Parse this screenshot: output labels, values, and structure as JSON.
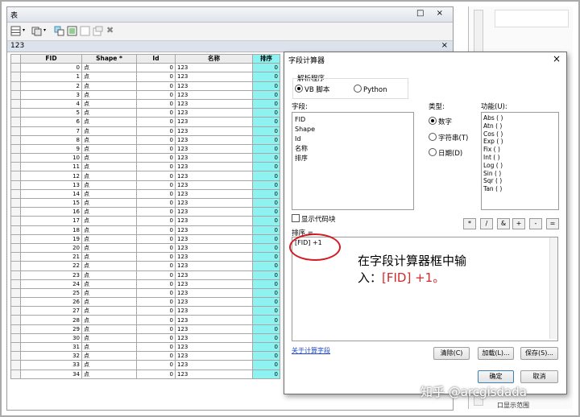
{
  "table_window": {
    "title": "表",
    "controls": "□ ×",
    "tab_name": "123",
    "tab_close": "×",
    "columns": [
      "FID",
      "Shape *",
      "Id",
      "名称",
      "排序"
    ],
    "rows": [
      [
        "0",
        "点",
        "0",
        "123",
        "0"
      ],
      [
        "1",
        "点",
        "0",
        "123",
        "0"
      ],
      [
        "2",
        "点",
        "0",
        "123",
        "0"
      ],
      [
        "3",
        "点",
        "0",
        "123",
        "0"
      ],
      [
        "4",
        "点",
        "0",
        "123",
        "0"
      ],
      [
        "5",
        "点",
        "0",
        "123",
        "0"
      ],
      [
        "6",
        "点",
        "0",
        "123",
        "0"
      ],
      [
        "7",
        "点",
        "0",
        "123",
        "0"
      ],
      [
        "8",
        "点",
        "0",
        "123",
        "0"
      ],
      [
        "9",
        "点",
        "0",
        "123",
        "0"
      ],
      [
        "10",
        "点",
        "0",
        "123",
        "0"
      ],
      [
        "11",
        "点",
        "0",
        "123",
        "0"
      ],
      [
        "12",
        "点",
        "0",
        "123",
        "0"
      ],
      [
        "13",
        "点",
        "0",
        "123",
        "0"
      ],
      [
        "14",
        "点",
        "0",
        "123",
        "0"
      ],
      [
        "15",
        "点",
        "0",
        "123",
        "0"
      ],
      [
        "16",
        "点",
        "0",
        "123",
        "0"
      ],
      [
        "17",
        "点",
        "0",
        "123",
        "0"
      ],
      [
        "18",
        "点",
        "0",
        "123",
        "0"
      ],
      [
        "19",
        "点",
        "0",
        "123",
        "0"
      ],
      [
        "20",
        "点",
        "0",
        "123",
        "0"
      ],
      [
        "21",
        "点",
        "0",
        "123",
        "0"
      ],
      [
        "22",
        "点",
        "0",
        "123",
        "0"
      ],
      [
        "23",
        "点",
        "0",
        "123",
        "0"
      ],
      [
        "24",
        "点",
        "0",
        "123",
        "0"
      ],
      [
        "25",
        "点",
        "0",
        "123",
        "0"
      ],
      [
        "26",
        "点",
        "0",
        "123",
        "0"
      ],
      [
        "27",
        "点",
        "0",
        "123",
        "0"
      ],
      [
        "28",
        "点",
        "0",
        "123",
        "0"
      ],
      [
        "29",
        "点",
        "0",
        "123",
        "0"
      ],
      [
        "30",
        "点",
        "0",
        "123",
        "0"
      ],
      [
        "31",
        "点",
        "0",
        "123",
        "0"
      ],
      [
        "32",
        "点",
        "0",
        "123",
        "0"
      ],
      [
        "33",
        "点",
        "0",
        "123",
        "0"
      ],
      [
        "34",
        "点",
        "0",
        "123",
        "0"
      ]
    ],
    "highlight_color": "#8ef3f0"
  },
  "dialog": {
    "title": "字段计算器",
    "close": "×",
    "parser_label": "解析程序",
    "parser_options": [
      "VB 脚本",
      "Python"
    ],
    "parser_selected": "VB 脚本",
    "fields_label": "字段:",
    "fields": [
      "FID",
      "Shape",
      "Id",
      "名称",
      "排序"
    ],
    "type_label": "类型:",
    "types": [
      "数字",
      "字符串(T)",
      "日期(D)"
    ],
    "type_selected": "数字",
    "functions_label": "功能(U):",
    "functions": [
      "Abs ( )",
      "Atn ( )",
      "Cos ( )",
      "Exp ( )",
      "Fix ( )",
      "Int ( )",
      "Log ( )",
      "Sin ( )",
      "Sqr ( )",
      "Tan ( )"
    ],
    "show_codeblock_label": "显示代码块",
    "operators": [
      "*",
      "/",
      "&",
      "+",
      "-",
      "="
    ],
    "expression_label": "排序 =",
    "expression_value": "[FID] +1",
    "help_link": "关于计算字段",
    "buttons": {
      "clear": "清除(C)",
      "load": "加载(L)...",
      "save": "保存(S)...",
      "ok": "确定",
      "cancel": "取消"
    }
  },
  "annotation": {
    "line1": "在字段计算器框中输",
    "line2_prefix": "入：",
    "line2_code": "[FID] +1",
    "line2_suffix": "。",
    "circle_color": "#d41a22"
  },
  "watermark": "知乎 @arcgisdada",
  "right_pane_text": "口显示范围"
}
